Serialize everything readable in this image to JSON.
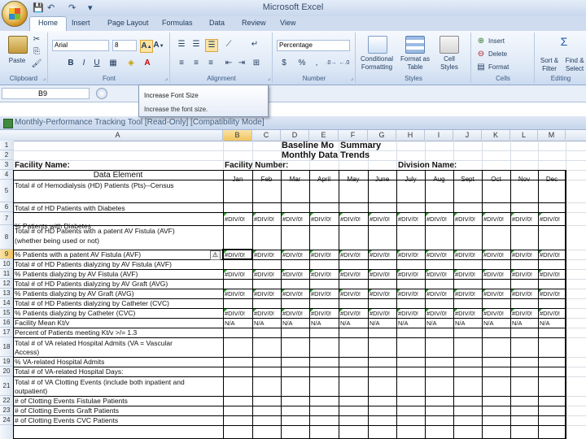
{
  "app": {
    "title": "Microsoft Excel",
    "workbook_title": "Monthly-Performance Tracking Tool  [Read-Only]  [Compatibility Mode]"
  },
  "qat": [
    "💾",
    "↶",
    "↷",
    "▾"
  ],
  "ribbon": {
    "tabs": [
      "Home",
      "Insert",
      "Page Layout",
      "Formulas",
      "Data",
      "Review",
      "View"
    ],
    "active_tab": "Home",
    "groups": {
      "clipboard": "Clipboard",
      "font": "Font",
      "alignment": "Alignment",
      "number": "Number",
      "styles": "Styles",
      "cells": "Cells",
      "editing": "Editing"
    },
    "paste_label": "Paste",
    "font_name": "Arial",
    "font_size": "8",
    "number_format": "Percentage",
    "number_buttons": [
      "$",
      "%",
      ","
    ],
    "font_buttons": [
      "B",
      "I",
      "U"
    ],
    "styles_buttons": [
      "Conditional Formatting",
      "Format as Table",
      "Cell Styles"
    ],
    "cells_buttons": [
      "Insert",
      "Delete",
      "Format"
    ],
    "editing_buttons": [
      "Sort & Filter",
      "Find & Select"
    ]
  },
  "formula_bar": {
    "name_box": "B9"
  },
  "tooltip": {
    "title": "Increase Font Size",
    "description": "Increase the font size."
  },
  "columns": [
    "A",
    "B",
    "C",
    "D",
    "E",
    "F",
    "G",
    "H",
    "I",
    "J",
    "K",
    "L",
    "M"
  ],
  "rows": [
    "1",
    "2",
    "3",
    "4",
    "5",
    "6",
    "7",
    "8",
    "9",
    "10",
    "11",
    "12",
    "13",
    "14",
    "15",
    "16",
    "17",
    "18",
    "19",
    "20",
    "21",
    "22",
    "23",
    "24"
  ],
  "sheet": {
    "title1": "Baseline Mo",
    "title1b": "Summary",
    "title2": "Monthly Data Trends",
    "facility_name_label": "Facility Name:",
    "facility_number_label": "Facility Number:",
    "division_name_label": "Division Name:",
    "data_element_header": "Data Element",
    "months": [
      "Jan",
      "Feb",
      "Mar",
      "April",
      "May",
      "June",
      "July",
      "Aug",
      "Sept",
      "Oct",
      "Nov",
      "Dec"
    ],
    "div0": "#DIV/0!",
    "na": "N/A",
    "elements": {
      "r4": "Total # of Hemodialysis (HD) Patients (Pts)--Census",
      "r6": "Total # of HD Patients with Diabetes",
      "r7": "% Patients with Diabetes",
      "r8a": "Total # of HD Patients with a patent AV Fistula (AVF)",
      "r8b": "(whether being used or not)",
      "r9": "% Patients with a patent AV Fistula (AVF)",
      "r10": "Total # of HD Patients dialyzing by AV Fistula (AVF)",
      "r11": "% Patients dialyzing by AV Fistula (AVF)",
      "r12": "Total # of HD Patients dialyzing by AV Graft (AVG)",
      "r13": "% Patients dialyzing by AV Graft (AVG)",
      "r14": "Total # of HD Patients dialyzing by Catheter (CVC)",
      "r15": "% Patients dialyzing by Catheter (CVC)",
      "r16": "Facility Mean Kt/v",
      "r17": "Percent of Patients meeting Kt/v >/= 1.3",
      "r18a": "Total # of VA related Hospital Admits (VA = Vascular",
      "r18b": "Access)",
      "r19": "% VA-related Hospital Admits",
      "r20": "Total # of VA-related Hospital Days:",
      "r21a": "Total # of VA Clotting Events (include both inpatient and",
      "r21b": "outpatient)",
      "r22": "# of Clotting Events Fistulae Patients",
      "r23": "# of Clotting Events Graft Patients",
      "r24": "# of Clotting Events CVC Patients"
    }
  }
}
